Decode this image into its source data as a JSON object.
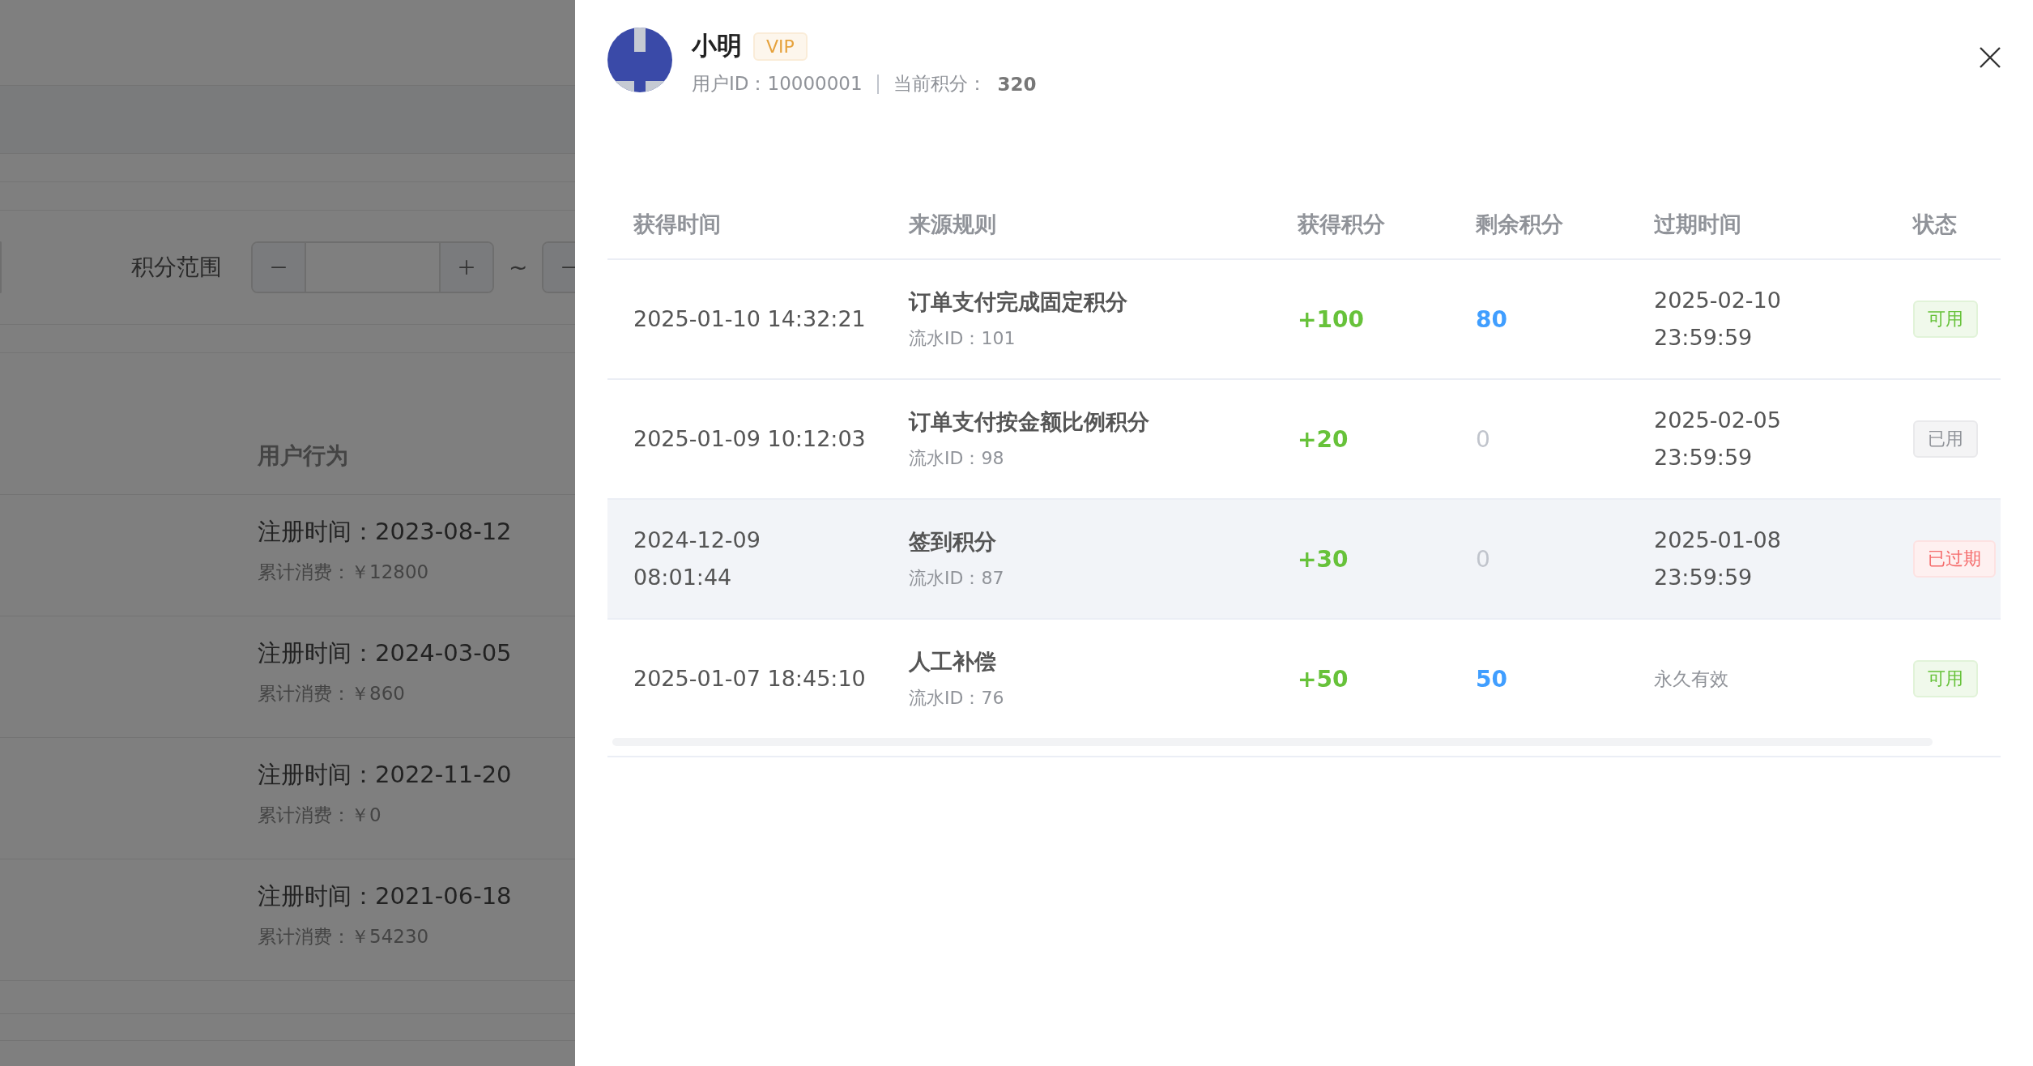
{
  "background_page": {
    "filter": {
      "label": "积分范围",
      "separator": "~"
    },
    "behavior_column": {
      "title": "用户行为",
      "rows": [
        {
          "registered": "注册时间：2023-08-12",
          "spend": "累计消费：￥12800"
        },
        {
          "registered": "注册时间：2024-03-05",
          "spend": "累计消费：￥860"
        },
        {
          "registered": "注册时间：2022-11-20",
          "spend": "累计消费：￥0"
        },
        {
          "registered": "注册时间：2021-06-18",
          "spend": "累计消费：￥54230"
        }
      ]
    }
  },
  "drawer": {
    "user": {
      "name": "小明",
      "badge": "VIP",
      "id_text": "用户ID：10000001",
      "points_label": "当前积分：",
      "points": "320"
    },
    "table": {
      "columns": [
        "获得时间",
        "来源规则",
        "获得积分",
        "剩余积分",
        "过期时间",
        "状态"
      ],
      "rows": [
        {
          "time": [
            "2025-01-10 14:32:21"
          ],
          "rule": "订单支付完成固定积分",
          "flow_id": "流水ID：101",
          "earned": "+100",
          "remaining": "80",
          "remaining_muted": false,
          "expiry": [
            "2025-02-10",
            "23:59:59"
          ],
          "expiry_permanent": false,
          "status": "可用",
          "kind": "available",
          "hovered": false
        },
        {
          "time": [
            "2025-01-09 10:12:03"
          ],
          "rule": "订单支付按金额比例积分",
          "flow_id": "流水ID：98",
          "earned": "+20",
          "remaining": "0",
          "remaining_muted": true,
          "expiry": [
            "2025-02-05",
            "23:59:59"
          ],
          "expiry_permanent": false,
          "status": "已用",
          "kind": "used",
          "hovered": false
        },
        {
          "time": [
            "2024-12-09",
            "08:01:44"
          ],
          "rule": "签到积分",
          "flow_id": "流水ID：87",
          "earned": "+30",
          "remaining": "0",
          "remaining_muted": true,
          "expiry": [
            "2025-01-08",
            "23:59:59"
          ],
          "expiry_permanent": false,
          "status": "已过期",
          "kind": "expired",
          "hovered": true
        },
        {
          "time": [
            "2025-01-07 18:45:10"
          ],
          "rule": "人工补偿",
          "flow_id": "流水ID：76",
          "earned": "+50",
          "remaining": "50",
          "remaining_muted": false,
          "expiry": [
            "永久有效"
          ],
          "expiry_permanent": true,
          "status": "可用",
          "kind": "available",
          "hovered": false
        }
      ]
    }
  }
}
